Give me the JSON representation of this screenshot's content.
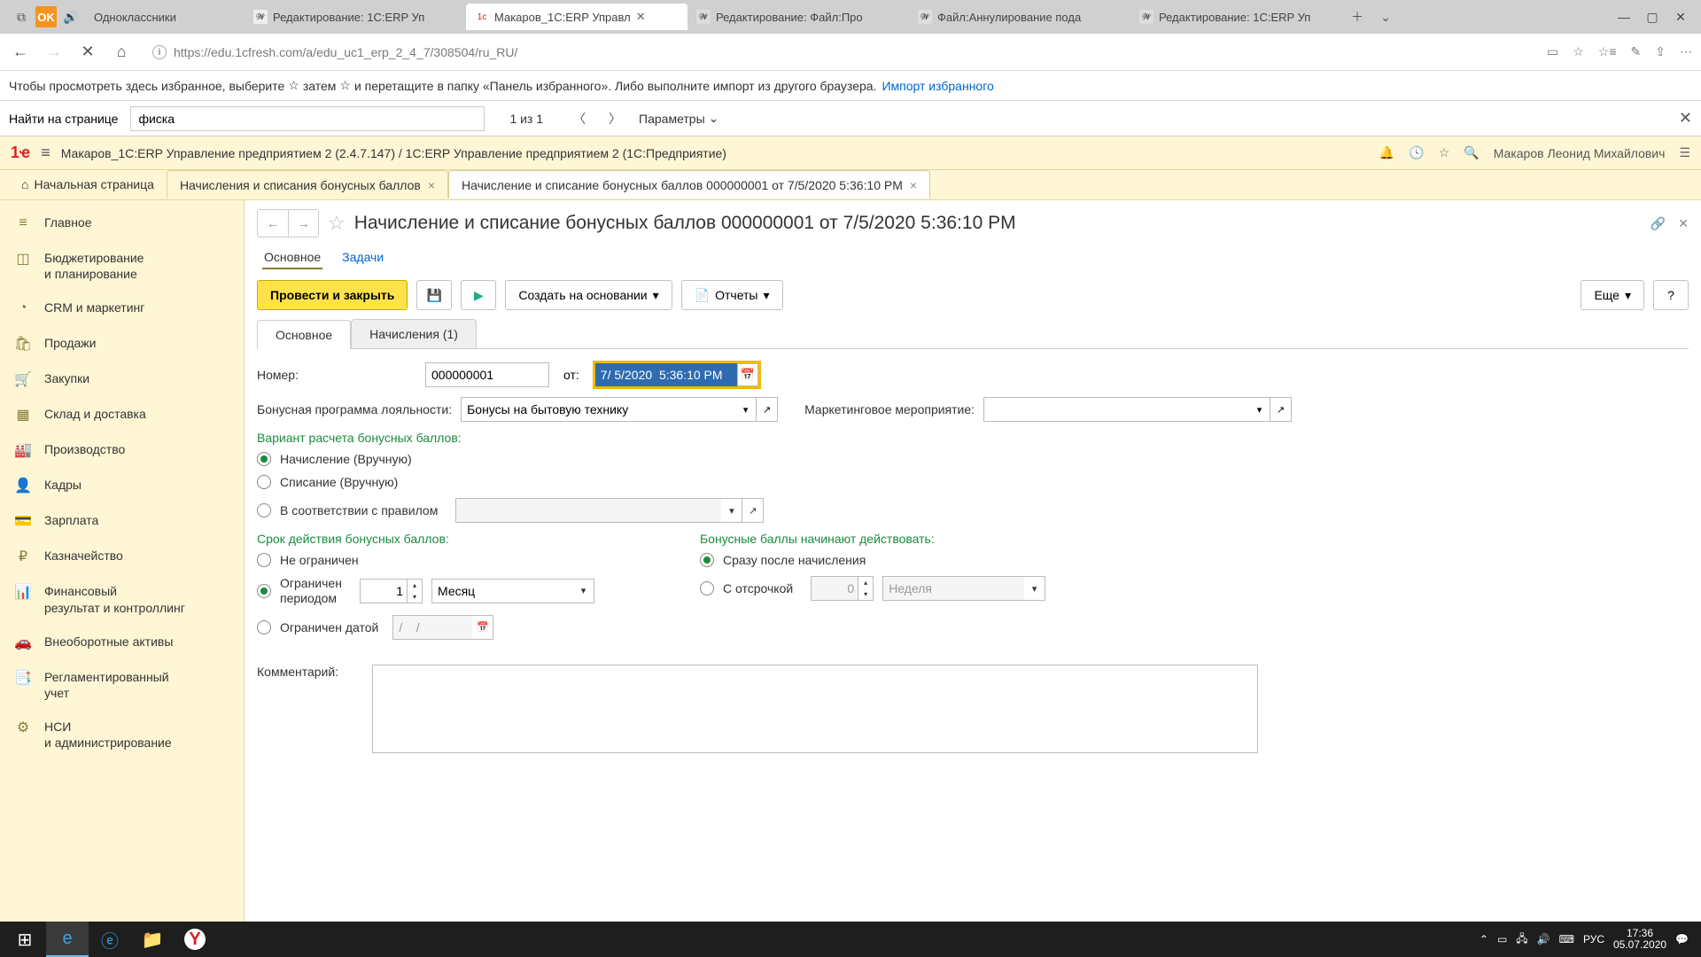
{
  "browser": {
    "tabs": [
      {
        "label": "Одноклассники",
        "fav_bg": "#f7931e"
      },
      {
        "label": "Редактирование: 1С:ERP Уп"
      },
      {
        "label": "Макаров_1С:ERP Управл",
        "active": true
      },
      {
        "label": "Редактирование: Файл:Про"
      },
      {
        "label": "Файл:Аннулирование пода"
      },
      {
        "label": "Редактирование: 1С:ERP Уп"
      }
    ],
    "url": "https://edu.1cfresh.com/a/edu_uc1_erp_2_4_7/308504/ru_RU/"
  },
  "favbar": {
    "text_before": "Чтобы просмотреть здесь избранное, выберите",
    "text_mid": "затем",
    "text_after": "и перетащите в папку «Панель избранного». Либо выполните импорт из другого браузера.",
    "link": "Импорт избранного"
  },
  "findbar": {
    "label": "Найти на странице",
    "value": "фиска",
    "count": "1 из 1",
    "params": "Параметры"
  },
  "erp": {
    "title": "Макаров_1С:ERP Управление предприятием 2 (2.4.7.147) / 1С:ERP Управление предприятием 2   (1С:Предприятие)",
    "user": "Макаров Леонид Михайлович",
    "tabs": {
      "home": "Начальная страница",
      "t1": "Начисления и списания бонусных баллов",
      "t2": "Начисление и списание бонусных баллов 000000001 от 7/5/2020 5:36:10 PM"
    }
  },
  "sidebar": {
    "items": [
      {
        "icon": "≡",
        "label": "Главное"
      },
      {
        "icon": "◫",
        "label": "Бюджетирование\nи планирование"
      },
      {
        "icon": "◔",
        "label": "CRM и маркетинг"
      },
      {
        "icon": "🛍",
        "label": "Продажи"
      },
      {
        "icon": "🛒",
        "label": "Закупки"
      },
      {
        "icon": "▦",
        "label": "Склад и доставка"
      },
      {
        "icon": "🏭",
        "label": "Производство"
      },
      {
        "icon": "👤",
        "label": "Кадры"
      },
      {
        "icon": "💳",
        "label": "Зарплата"
      },
      {
        "icon": "₽",
        "label": "Казначейство"
      },
      {
        "icon": "📊",
        "label": "Финансовый\nрезультат и контроллинг"
      },
      {
        "icon": "🚗",
        "label": "Внеоборотные активы"
      },
      {
        "icon": "📑",
        "label": "Регламентированный\nучет"
      },
      {
        "icon": "⚙",
        "label": "НСИ\nи администрирование"
      }
    ]
  },
  "form": {
    "title": "Начисление и списание бонусных баллов 000000001 от 7/5/2020 5:36:10 PM",
    "subtabs": {
      "main": "Основное",
      "tasks": "Задачи"
    },
    "toolbar": {
      "post_close": "Провести и закрыть",
      "create_based": "Создать на основании",
      "reports": "Отчеты",
      "more": "Еще"
    },
    "inner_tabs": {
      "main": "Основное",
      "accruals": "Начисления (1)"
    },
    "labels": {
      "number": "Номер:",
      "from": "от:",
      "loyalty": "Бонусная программа лояльности:",
      "marketing": "Маркетинговое мероприятие:",
      "variant": "Вариант расчета бонусных баллов:",
      "manual_accrual": "Начисление (Вручную)",
      "manual_writeoff": "Списание (Вручную)",
      "by_rule": "В соответствии с правилом",
      "validity": "Срок действия бонусных баллов:",
      "unlimited": "Не ограничен",
      "limited_period": "Ограничен периодом",
      "limited_date": "Ограничен датой",
      "take_effect": "Бонусные баллы начинают действовать:",
      "immediately": "Сразу после начисления",
      "delayed": "С отсрочкой",
      "month": "Месяц",
      "week": "Неделя",
      "comment": "Комментарий:",
      "date_placeholder": "/    /"
    },
    "values": {
      "number": "000000001",
      "date": "7/ 5/2020  5:36:10 PM",
      "loyalty": "Бонусы на бытовую технику",
      "marketing": "",
      "period_qty": "1",
      "delay_qty": "0"
    }
  },
  "taskbar": {
    "lang": "РУС",
    "time": "17:36",
    "date": "05.07.2020"
  }
}
